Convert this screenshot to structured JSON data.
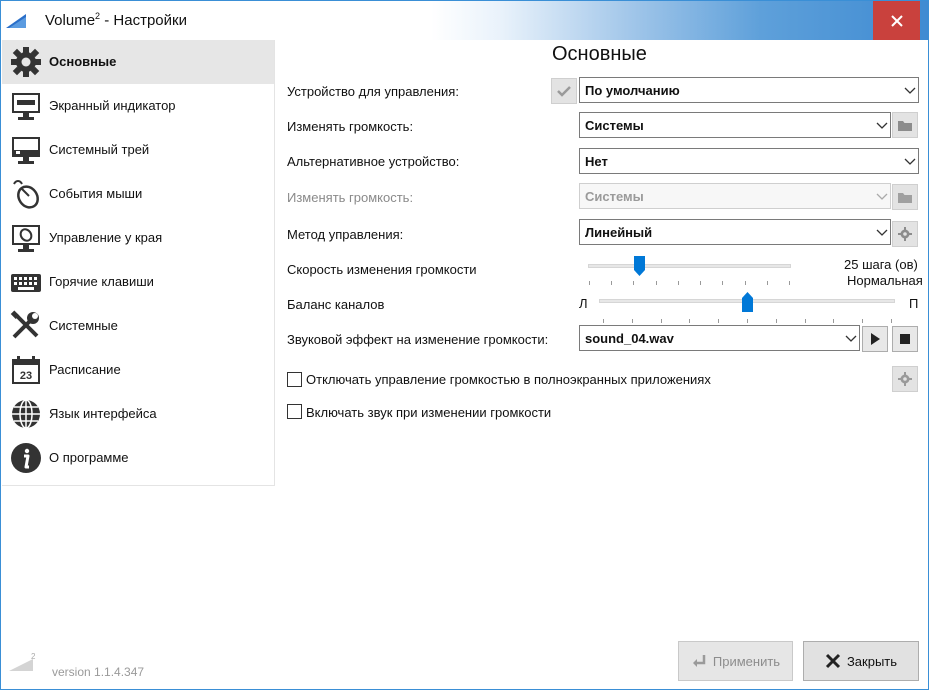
{
  "window": {
    "title_main": "Volume",
    "title_sup": "2",
    "title_rest": " - Настройки"
  },
  "sidebar": {
    "items": [
      {
        "label": "Основные",
        "icon": "gear-icon"
      },
      {
        "label": "Экранный индикатор",
        "icon": "monitor-icon"
      },
      {
        "label": "Системный трей",
        "icon": "tray-icon"
      },
      {
        "label": "События мыши",
        "icon": "mouse-icon"
      },
      {
        "label": "Управление у края",
        "icon": "screen-edge-icon"
      },
      {
        "label": "Горячие клавиши",
        "icon": "keyboard-icon"
      },
      {
        "label": "Системные",
        "icon": "tools-icon"
      },
      {
        "label": "Расписание",
        "icon": "calendar-icon"
      },
      {
        "label": "Язык интерфейса",
        "icon": "globe-icon"
      },
      {
        "label": "О программе",
        "icon": "info-icon"
      }
    ],
    "calendar_day": "23",
    "version": "version 1.1.4.347",
    "logo_sup": "2"
  },
  "main": {
    "title": "Основные",
    "device_label": "Устройство для управления:",
    "device_value": "По умолчанию",
    "volume_label": "Изменять громкость:",
    "volume_value": "Системы",
    "alt_device_label": "Альтернативное устройство:",
    "alt_device_value": "Нет",
    "alt_volume_label": "Изменять громкость:",
    "alt_volume_value": "Системы",
    "method_label": "Метод управления:",
    "method_value": "Линейный",
    "speed_label": "Скорость изменения громкости",
    "speed_value_text": "25 шага (ов)",
    "speed_desc": "Нормальная",
    "speed_position": 0.25,
    "balance_label": "Баланс каналов",
    "balance_left": "Л",
    "balance_right": "П",
    "balance_position": 0.5,
    "sound_label": "Звуковой эффект на изменение громкости:",
    "sound_value": "sound_04.wav",
    "fullscreen_checkbox": "Отключать управление громкостью в полноэкранных приложениях",
    "fullscreen_checked": false,
    "sound_checkbox": "Включать звук при изменении громкости",
    "sound_checked": false
  },
  "buttons": {
    "apply": "Применить",
    "close": "Закрыть"
  },
  "colors": {
    "accent": "#0078d7",
    "close": "#c9413d",
    "selected_nav": "#e6e6e6"
  }
}
